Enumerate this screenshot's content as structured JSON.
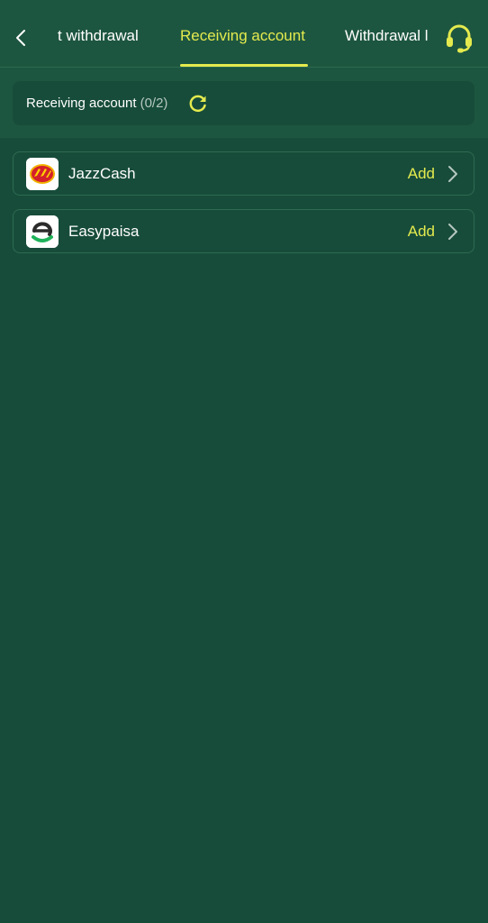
{
  "nav": {
    "tabs": [
      {
        "label": "t withdrawal"
      },
      {
        "label": "Receiving account",
        "active": true
      },
      {
        "label": "Withdrawal l"
      }
    ]
  },
  "summary": {
    "label": "Receiving account",
    "count": "(0/2)"
  },
  "accounts": [
    {
      "name": "JazzCash",
      "action": "Add",
      "icon": "jazzcash-logo"
    },
    {
      "name": "Easypaisa",
      "action": "Add",
      "icon": "easypaisa-logo"
    }
  ],
  "colors": {
    "accent": "#e4ea4e",
    "background": "#174c3a",
    "header": "#1d5640"
  }
}
